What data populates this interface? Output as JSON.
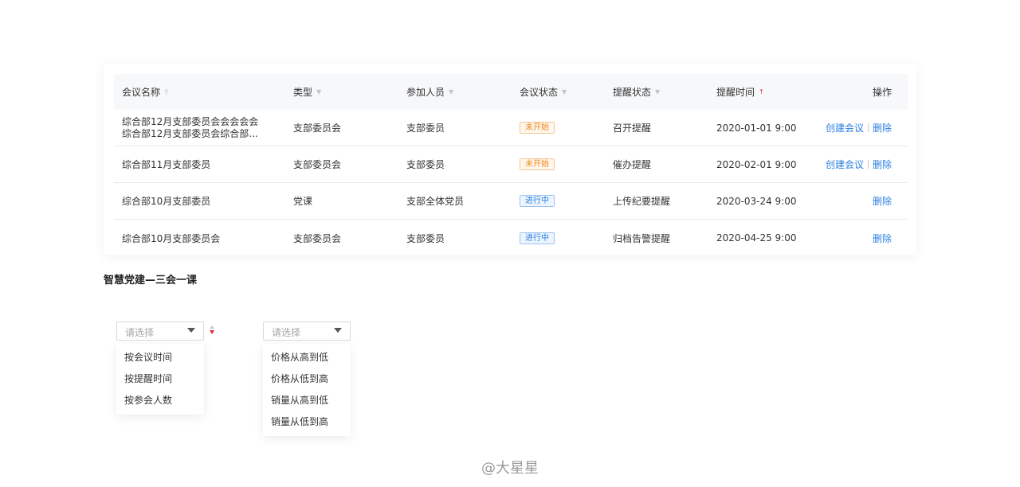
{
  "table": {
    "headers": {
      "name": "会议名称",
      "type": "类型",
      "participants": "参加人员",
      "meeting_status": "会议状态",
      "remind_status": "提醒状态",
      "remind_time": "提醒时间",
      "actions": "操作"
    },
    "rows": [
      {
        "name_line1": "综合部12月支部委员会会会会会",
        "name_line2": "综合部12月支部委员会综合部...",
        "type": "支部委员会",
        "participants": "支部委员",
        "status": "未开始",
        "remind": "召开提醒",
        "time": "2020-01-01  9:00",
        "create": "创建会议",
        "delete": "删除"
      },
      {
        "name": "综合部11月支部委员",
        "type": "支部委员会",
        "participants": "支部委员",
        "status": "未开始",
        "remind": "催办提醒",
        "time": "2020-02-01  9:00",
        "create": "创建会议",
        "delete": "删除"
      },
      {
        "name": "综合部10月支部委员",
        "type": "党课",
        "participants": "支部全体党员",
        "status": "进行中",
        "remind": "上传纪要提醒",
        "time": "2020-03-24  9:00",
        "delete": "删除"
      },
      {
        "name": "综合部10月支部委员会",
        "type": "支部委员会",
        "participants": "支部委员",
        "status": "进行中",
        "remind": "归档告警提醒",
        "time": "2020-04-25  9:00",
        "delete": "删除"
      }
    ]
  },
  "caption": "智慧党建—三会一课",
  "dropdown1": {
    "placeholder": "请选择",
    "options": [
      "按会议时间",
      "按提醒时间",
      "按参会人数"
    ]
  },
  "dropdown2": {
    "placeholder": "请选择",
    "options": [
      "价格从高到低",
      "价格从低到高",
      "销量从高到低",
      "销量从低到高"
    ]
  },
  "watermark": "@大星星",
  "colors": {
    "link": "#2d7fe0",
    "pending": "#f08a1d",
    "running": "#2d7fe0",
    "sort_active": "#e02e3c"
  }
}
